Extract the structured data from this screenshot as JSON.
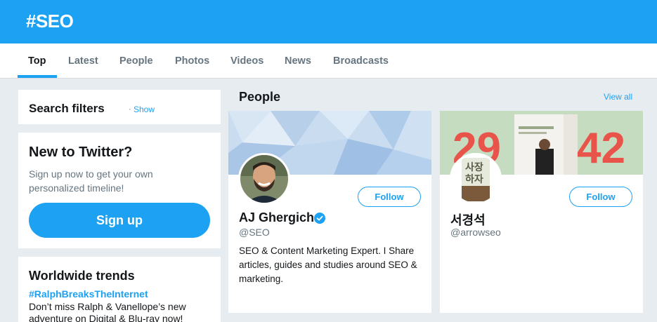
{
  "header": {
    "title": "#SEO"
  },
  "tabs": [
    {
      "label": "Top",
      "active": true
    },
    {
      "label": "Latest"
    },
    {
      "label": "People"
    },
    {
      "label": "Photos"
    },
    {
      "label": "Videos"
    },
    {
      "label": "News"
    },
    {
      "label": "Broadcasts"
    }
  ],
  "search_filters": {
    "title": "Search filters",
    "separator": "·",
    "show_label": "Show"
  },
  "new_to_twitter": {
    "title": "New to Twitter?",
    "text": "Sign up now to get your own personalized timeline!",
    "signup_label": "Sign up"
  },
  "trends": {
    "title": "Worldwide trends",
    "items": [
      {
        "hashtag": "#RalphBreaksTheInternet",
        "description": "Don’t miss Ralph & Vanellope’s new adventure on Digital & Blu-ray now!"
      }
    ]
  },
  "people": {
    "title": "People",
    "view_all_label": "View all",
    "cards": [
      {
        "name": "AJ Ghergich",
        "handle": "@SEO",
        "verified": true,
        "follow_label": "Follow",
        "bio": "SEO & Content Marketing Expert. I Share articles, guides and studies around SEO & marketing."
      },
      {
        "name": "서경석",
        "handle": "@arrowseo",
        "verified": false,
        "follow_label": "Follow",
        "bio": "",
        "banner_numbers": [
          "29",
          "42"
        ],
        "avatar_text": [
          "사장",
          "하자"
        ]
      }
    ]
  },
  "colors": {
    "brand": "#1da1f2",
    "background": "#e6ecf0",
    "banner_red": "#e8534a",
    "banner_green": "#c5dcc0"
  }
}
